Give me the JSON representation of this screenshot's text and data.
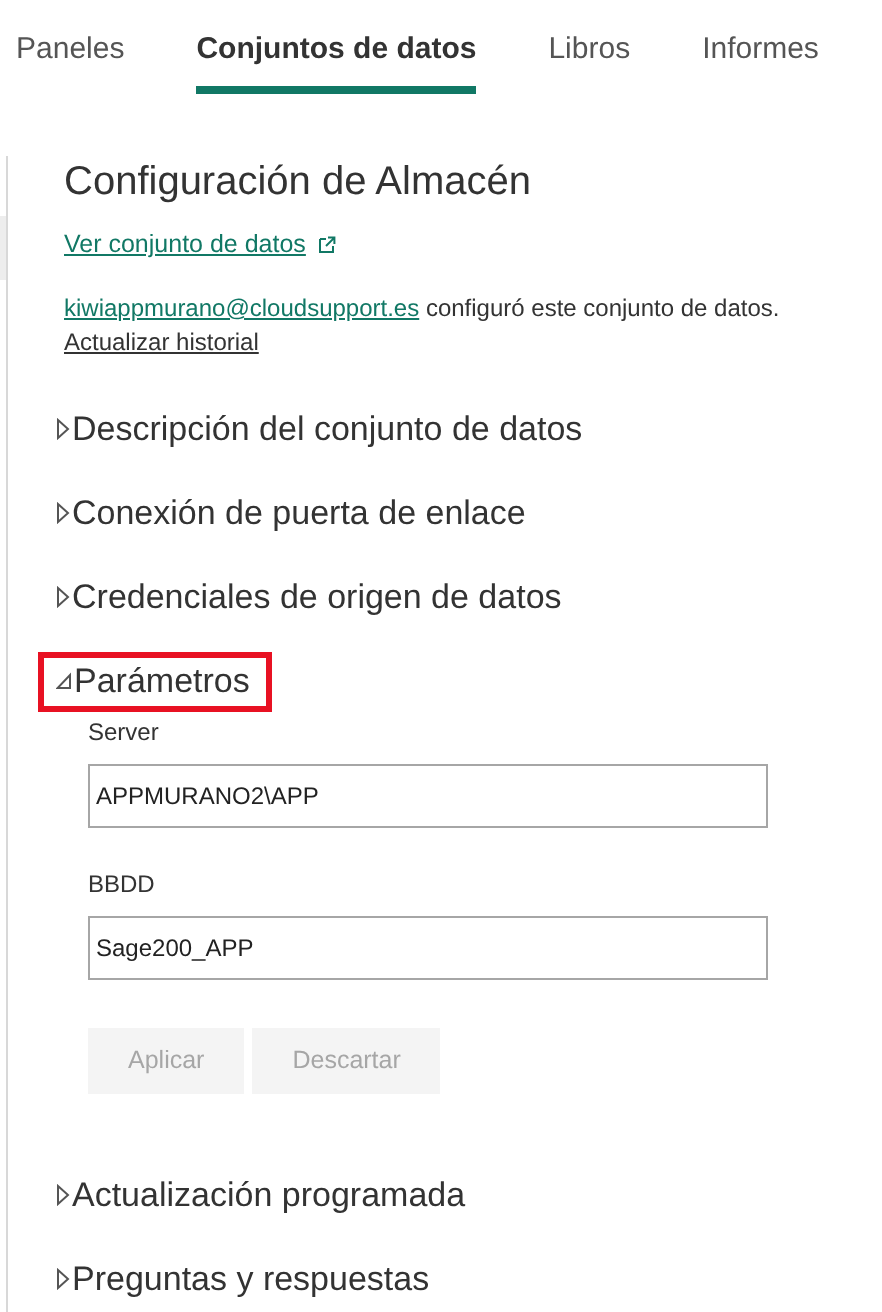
{
  "tabs": [
    {
      "label": "Paneles",
      "selected": false
    },
    {
      "label": "Conjuntos de datos",
      "selected": true
    },
    {
      "label": "Libros",
      "selected": false
    },
    {
      "label": "Informes",
      "selected": false
    }
  ],
  "title": "Configuración de Almacén",
  "view_link": "Ver conjunto de datos",
  "configured_by": {
    "email": "kiwiappmurano@cloudsupport.es",
    "text": "configuró este conjunto de datos.",
    "history_link": "Actualizar historial"
  },
  "sections": [
    {
      "label": "Descripción del conjunto de datos",
      "expanded": false,
      "highlighted": false
    },
    {
      "label": "Conexión de puerta de enlace",
      "expanded": false,
      "highlighted": false
    },
    {
      "label": "Credenciales de origen de datos",
      "expanded": false,
      "highlighted": false
    },
    {
      "label": "Parámetros",
      "expanded": true,
      "highlighted": true,
      "fields": [
        {
          "label": "Server",
          "value": "APPMURANO2\\APP"
        },
        {
          "label": "BBDD",
          "value": "Sage200_APP"
        }
      ],
      "buttons": [
        {
          "label": "Aplicar",
          "disabled": true
        },
        {
          "label": "Descartar",
          "disabled": true
        }
      ]
    },
    {
      "label": "Actualización programada",
      "expanded": false,
      "highlighted": false
    },
    {
      "label": "Preguntas y respuestas",
      "expanded": false,
      "highlighted": false
    }
  ]
}
